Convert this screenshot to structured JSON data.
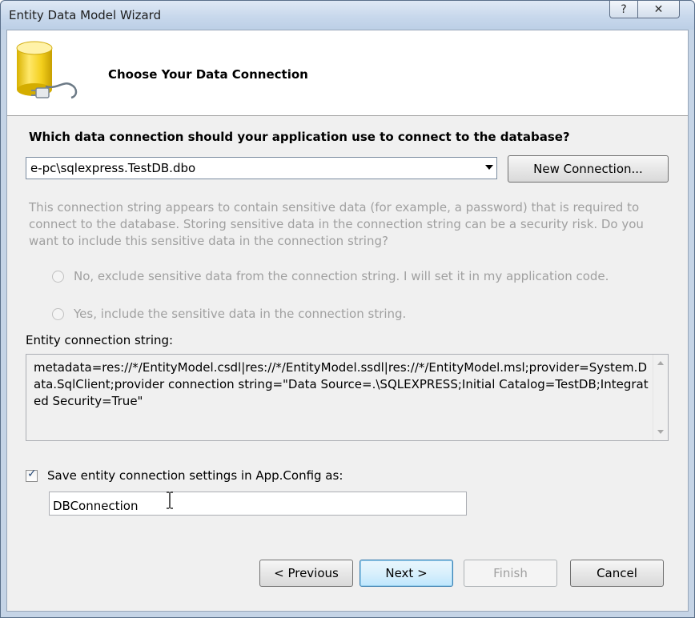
{
  "window": {
    "title": "Entity Data Model Wizard",
    "help_label": "?",
    "close_label": "✕"
  },
  "header": {
    "title": "Choose Your Data Connection",
    "icon": "database-plug-icon"
  },
  "connection": {
    "question": "Which data connection should your application use to connect to the database?",
    "selected": "e-pc\\sqlexpress.TestDB.dbo",
    "new_connection_label": "New Connection..."
  },
  "sensitive": {
    "info": "This connection string appears to contain sensitive data (for example, a password) that is required to connect to the database. Storing sensitive data in the connection string can be a security risk. Do you want to include this sensitive data in the connection string?",
    "option_no": "No, exclude sensitive data from the connection string. I will set it in my application code.",
    "option_yes": "Yes, include the sensitive data in the connection string."
  },
  "entity_string": {
    "label": "Entity connection string:",
    "value": "metadata=res://*/EntityModel.csdl|res://*/EntityModel.ssdl|res://*/EntityModel.msl;provider=System.Data.SqlClient;provider connection string=\"Data Source=.\\SQLEXPRESS;Initial Catalog=TestDB;Integrated Security=True\""
  },
  "save": {
    "checked": true,
    "label": "Save entity connection settings in App.Config as:",
    "name_value": "DBConnection"
  },
  "footer": {
    "previous_label": "< Previous",
    "next_label": "Next >",
    "finish_label": "Finish",
    "cancel_label": "Cancel"
  },
  "colors": {
    "title_bar": "#c8d8ec",
    "client_bg": "#f0f0f0",
    "disabled_text": "#a0a0a0",
    "default_button_border": "#3c7fb1"
  }
}
